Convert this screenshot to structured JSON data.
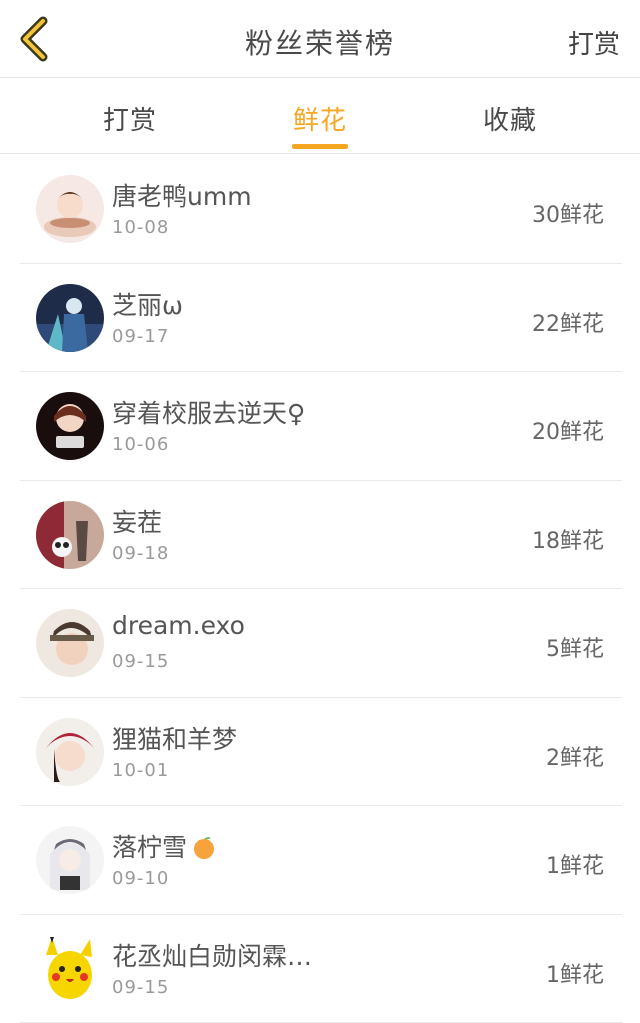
{
  "nav": {
    "title": "粉丝荣誉榜",
    "right": "打赏",
    "back_icon": "chevron-left-icon",
    "accent": "#f5a623"
  },
  "tabs": [
    {
      "label": "打赏"
    },
    {
      "label": "鲜花",
      "active": true
    },
    {
      "label": "收藏"
    }
  ],
  "rows": [
    {
      "name": "唐老鸭umm",
      "date": "10-08",
      "flowers": "30鲜花"
    },
    {
      "name": "芝丽ω",
      "date": "09-17",
      "flowers": "22鲜花"
    },
    {
      "name": "穿着校服去逆天♀",
      "date": "10-06",
      "flowers": "20鲜花"
    },
    {
      "name": "妄茬",
      "date": "09-18",
      "flowers": "18鲜花"
    },
    {
      "name": "dream.exo",
      "date": "09-15",
      "flowers": "5鲜花"
    },
    {
      "name": "狸猫和羊梦",
      "date": "10-01",
      "flowers": "2鲜花"
    },
    {
      "name": "落柠雪",
      "date": "09-10",
      "flowers": "1鲜花"
    },
    {
      "name": "花丞灿白勋闵霖…",
      "date": "09-15",
      "flowers": "1鲜花"
    }
  ]
}
